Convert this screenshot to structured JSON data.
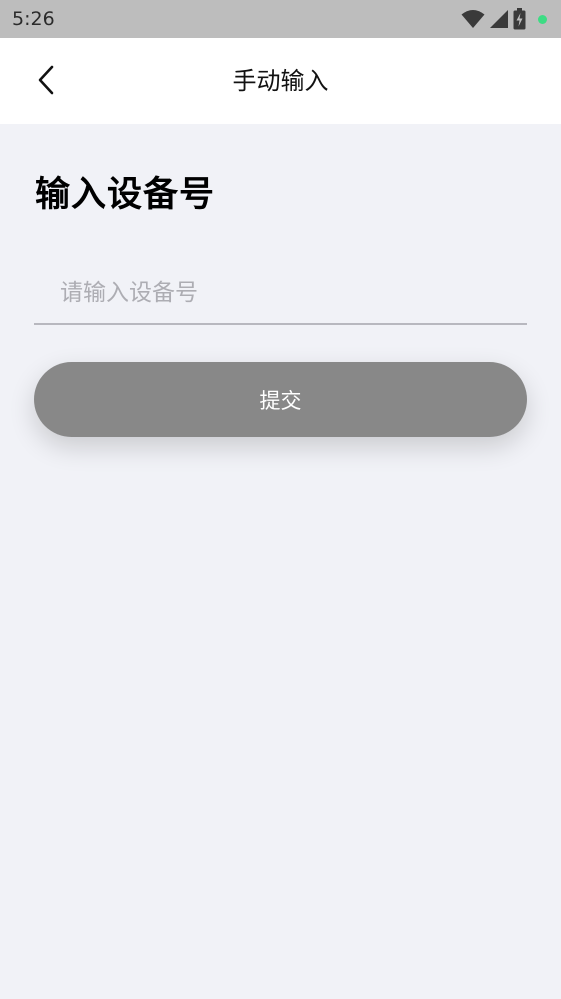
{
  "status_bar": {
    "time": "5:26",
    "icons": [
      "wifi-icon",
      "signal-icon",
      "battery-icon",
      "notification-dot-icon"
    ],
    "dot_color": "#3ddc84",
    "background": "#bdbdbd"
  },
  "nav": {
    "title": "手动输入",
    "back_icon": "chevron-left-icon"
  },
  "form": {
    "heading": "输入设备号",
    "device_input": {
      "value": "",
      "placeholder": "请输入设备号"
    },
    "submit_label": "提交",
    "submit_color": "#888888"
  }
}
